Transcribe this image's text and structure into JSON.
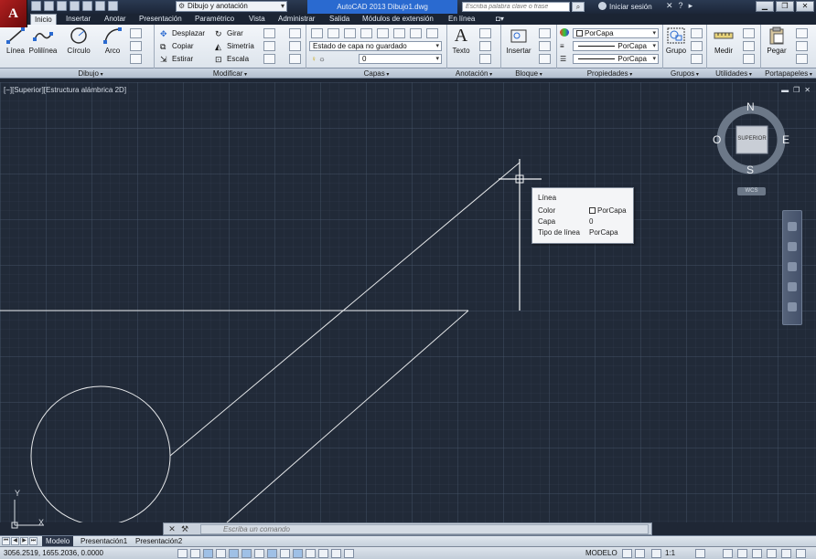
{
  "app": {
    "logo_letter": "A",
    "window_title": "AutoCAD 2013    Dibujo1.dwg",
    "workspace": "Dibujo y anotación",
    "search_placeholder": "Escriba palabra clave o frase",
    "signin": "Iniciar sesión",
    "title_icons": [
      "✕",
      "?",
      "▸"
    ]
  },
  "tabs": [
    "Inicio",
    "Insertar",
    "Anotar",
    "Presentación",
    "Paramétrico",
    "Vista",
    "Administrar",
    "Salida",
    "Módulos de extensión",
    "En línea"
  ],
  "ribbon": {
    "dibujo": {
      "tools": [
        "Línea",
        "Polilínea",
        "Círculo",
        "Arco"
      ],
      "label": "Dibujo"
    },
    "modificar": {
      "tools": [
        "Desplazar",
        "Girar",
        "Copiar",
        "Simetría",
        "Estirar",
        "Escala"
      ],
      "label": "Modificar"
    },
    "capas": {
      "state": "Estado de capa no guardado",
      "current": "0",
      "label": "Capas"
    },
    "anotacion": {
      "tool": "Texto",
      "label": "Anotación"
    },
    "bloque": {
      "tool": "Insertar",
      "label": "Bloque"
    },
    "propiedades": {
      "color": "PorCapa",
      "linetype": "PorCapa",
      "lineweight": "PorCapa",
      "label": "Propiedades"
    },
    "grupos": {
      "tool": "Grupo",
      "label": "Grupos"
    },
    "utilidades": {
      "tool": "Medir",
      "label": "Utilidades"
    },
    "portapapeles": {
      "tool": "Pegar",
      "label": "Portapapeles"
    }
  },
  "viewport": {
    "label": "[−][Superior][Estructura alámbrica 2D]",
    "controls": [
      "▬",
      "❐",
      "✕"
    ]
  },
  "tooltip": {
    "title": "Línea",
    "rows": [
      {
        "key": "Color",
        "value": "PorCapa"
      },
      {
        "key": "Capa",
        "value": "0"
      },
      {
        "key": "Tipo de línea",
        "value": "PorCapa"
      }
    ]
  },
  "viewcube": {
    "n": "N",
    "s": "S",
    "e": "E",
    "w": "O",
    "face": "SUPERIOR",
    "wcs": "WCS"
  },
  "ucs": {
    "y": "Y",
    "x": "X"
  },
  "layout_tabs": [
    "Modelo",
    "Presentación1",
    "Presentación2"
  ],
  "command": {
    "placeholder": "Escriba un comando"
  },
  "status": {
    "coords": "3056.2519, 1655.2036, 0.0000",
    "model": "MODELO",
    "scale": "1:1"
  },
  "colors": {
    "accent": "#2a6ad0",
    "canvas": "#212a38",
    "geometry": "#e6e8ea"
  }
}
